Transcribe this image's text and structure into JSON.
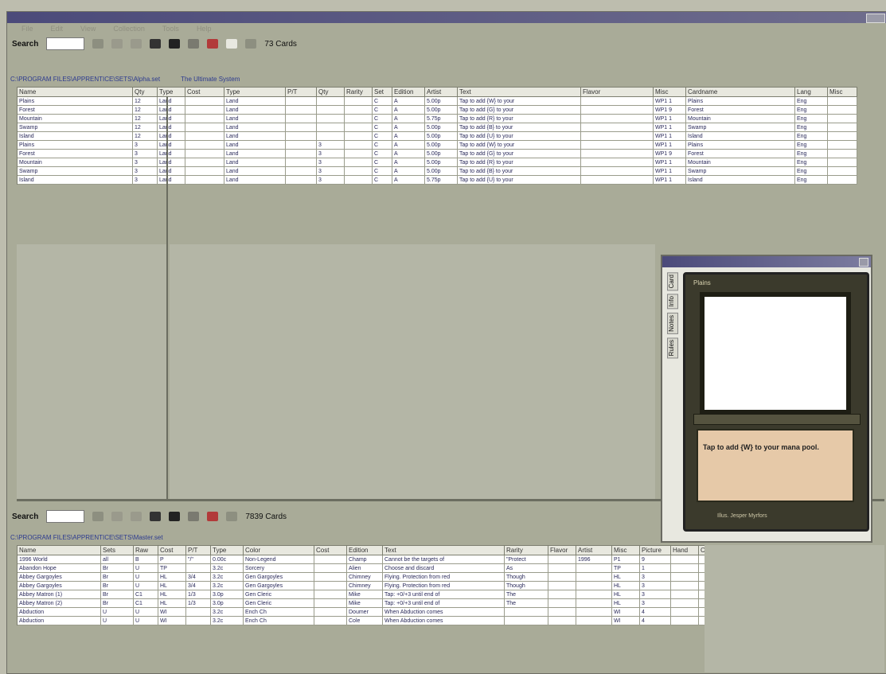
{
  "app": {
    "title": ""
  },
  "menu": [
    "File",
    "Edit",
    "View",
    "Collection",
    "Tools",
    "Help"
  ],
  "top_toolbar": {
    "search_label": "Search",
    "search_value": "",
    "count_label": "73 Cards"
  },
  "top_path": {
    "path": "C:\\PROGRAM FILES\\APPRENTICE\\SETS\\Alpha.set",
    "title": "The Ultimate System"
  },
  "top_grid": {
    "columns": [
      "Name",
      "Qty",
      "Type",
      "Cost",
      "Type",
      "P/T",
      "Qty",
      "Rarity",
      "Set",
      "Edition",
      "Artist",
      "Text",
      "Flavor",
      "Misc",
      "Cardname",
      "Lang",
      "Misc"
    ],
    "rows": [
      [
        "Plains",
        "12",
        "Land",
        "",
        "Land",
        "",
        "",
        "",
        "C",
        "A",
        "5.00p",
        "Tap to add {W} to your",
        "",
        "WP1 1",
        "Plains",
        "Eng",
        ""
      ],
      [
        "Forest",
        "12",
        "Land",
        "",
        "Land",
        "",
        "",
        "",
        "C",
        "A",
        "5.00p",
        "Tap to add {G} to your",
        "",
        "WP1 9",
        "Forest",
        "Eng",
        ""
      ],
      [
        "Mountain",
        "12",
        "Land",
        "",
        "Land",
        "",
        "",
        "",
        "C",
        "A",
        "5.75p",
        "Tap to add {R} to your",
        "",
        "WP1 1",
        "Mountain",
        "Eng",
        ""
      ],
      [
        "Swamp",
        "12",
        "Land",
        "",
        "Land",
        "",
        "",
        "",
        "C",
        "A",
        "5.00p",
        "Tap to add {B} to your",
        "",
        "WP1 1",
        "Swamp",
        "Eng",
        ""
      ],
      [
        "Island",
        "12",
        "Land",
        "",
        "Land",
        "",
        "",
        "",
        "C",
        "A",
        "5.00p",
        "Tap to add {U} to your",
        "",
        "WP1 1",
        "Island",
        "Eng",
        ""
      ],
      [
        "Plains",
        "3",
        "Land",
        "",
        "Land",
        "",
        "3",
        "",
        "C",
        "A",
        "5.00p",
        "Tap to add {W} to your",
        "",
        "WP1 1",
        "Plains",
        "Eng",
        ""
      ],
      [
        "Forest",
        "3",
        "Land",
        "",
        "Land",
        "",
        "3",
        "",
        "C",
        "A",
        "5.00p",
        "Tap to add {G} to your",
        "",
        "WP1 9",
        "Forest",
        "Eng",
        ""
      ],
      [
        "Mountain",
        "3",
        "Land",
        "",
        "Land",
        "",
        "3",
        "",
        "C",
        "A",
        "5.00p",
        "Tap to add {R} to your",
        "",
        "WP1 1",
        "Mountain",
        "Eng",
        ""
      ],
      [
        "Swamp",
        "3",
        "Land",
        "",
        "Land",
        "",
        "3",
        "",
        "C",
        "A",
        "5.00p",
        "Tap to add {B} to your",
        "",
        "WP1 1",
        "Swamp",
        "Eng",
        ""
      ],
      [
        "Island",
        "3",
        "Land",
        "",
        "Land",
        "",
        "3",
        "",
        "C",
        "A",
        "5.75p",
        "Tap to add {U} to your",
        "",
        "WP1 1",
        "Island",
        "Eng",
        ""
      ]
    ]
  },
  "bottom_toolbar": {
    "search_label": "Search",
    "search_value": "",
    "count_label": "7839 Cards"
  },
  "bottom_path": {
    "path": "C:\\PROGRAM FILES\\APPRENTICE\\SETS\\Master.set"
  },
  "bottom_grid": {
    "columns": [
      "Name",
      "Sets",
      "Raw",
      "Cost",
      "P/T",
      "Type",
      "Color",
      "Cost",
      "Edition",
      "Text",
      "Rarity",
      "Flavor",
      "Artist",
      "Misc",
      "Picture",
      "Hand",
      "Cost"
    ],
    "rows": [
      [
        "1996 World",
        "all",
        "B",
        "P",
        "\"/\"",
        "0.00c",
        "Non-Legend",
        "",
        "Champ",
        "Cannot be the targets of",
        "\"Protect",
        "",
        "1996",
        "P1",
        "9",
        "",
        ""
      ],
      [
        "Abandon Hope",
        "Br",
        "U",
        "TP",
        "",
        "3.2c",
        "Sorcery",
        "",
        "Alien",
        "Choose and discard",
        "As",
        "",
        "",
        "TP",
        "1",
        "",
        "",
        ""
      ],
      [
        "Abbey Gargoyles",
        "Br",
        "U",
        "HL",
        "3/4",
        "3.2c",
        "Gen Gargoyles",
        "",
        "Chimney",
        "Flying. Protection from red",
        "Though",
        "",
        "",
        "HL",
        "3",
        "",
        "",
        ""
      ],
      [
        "Abbey Gargoyles",
        "Br",
        "U",
        "HL",
        "3/4",
        "3.2c",
        "Gen Gargoyles",
        "",
        "Chimney",
        "Flying. Protection from red",
        "Though",
        "",
        "",
        "HL",
        "3",
        "",
        "",
        ""
      ],
      [
        "Abbey Matron (1)",
        "Br",
        "C1",
        "HL",
        "1/3",
        "3.0p",
        "Gen Cleric",
        "",
        "Mike",
        "Tap: +0/+3 until end of",
        "The",
        "",
        "",
        "HL",
        "3",
        "",
        "",
        ""
      ],
      [
        "Abbey Matron (2)",
        "Br",
        "C1",
        "HL",
        "1/3",
        "3.0p",
        "Gen Cleric",
        "",
        "Mike",
        "Tap: +0/+3 until end of",
        "The",
        "",
        "",
        "HL",
        "3",
        "",
        "",
        ""
      ],
      [
        "Abduction",
        "U",
        "U",
        "WI",
        "",
        "3.2c",
        "Ench Ch",
        "",
        "Doumer",
        "When Abduction comes",
        "",
        "",
        "",
        "WI",
        "4",
        "",
        "",
        ""
      ],
      [
        "Abduction",
        "U",
        "U",
        "WI",
        "",
        "3.2c",
        "Ench Ch",
        "",
        "Cole",
        "When Abduction comes",
        "",
        "",
        "",
        "WI",
        "4",
        "",
        "",
        ""
      ]
    ]
  },
  "preview": {
    "tabs": [
      "Card",
      "Info",
      "Notes",
      "Rules"
    ],
    "card_name": "Plains",
    "card_text": "Tap to add {W} to your mana pool.",
    "illustrator": "Illus. Jesper Myrfors"
  },
  "colors": {
    "window_bg": "#a9ab98",
    "titlebar": "#4b4a7a",
    "grid_bg": "#ffffff",
    "card_frame": "#3b3a2c",
    "card_text_bg": "#e6c9a8"
  }
}
